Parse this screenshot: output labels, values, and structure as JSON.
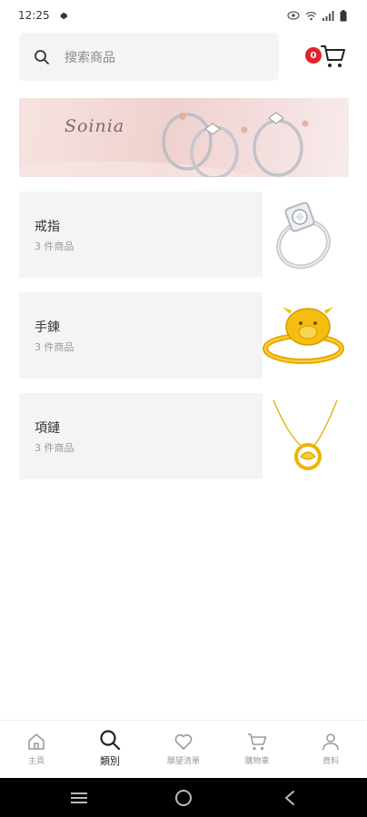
{
  "status_bar": {
    "time": "12:25"
  },
  "search": {
    "placeholder": "搜索商品"
  },
  "cart": {
    "count": "0"
  },
  "banner": {
    "brand_text": "Soinia"
  },
  "categories": [
    {
      "name": "戒指",
      "count": "3 件商品",
      "icon": "ring-image"
    },
    {
      "name": "手鍊",
      "count": "3 件商品",
      "icon": "bracelet-image"
    },
    {
      "name": "項鏈",
      "count": "3 件商品",
      "icon": "necklace-image"
    }
  ],
  "tabs": [
    {
      "label": "主頁",
      "icon": "home-icon",
      "active": false
    },
    {
      "label": "類別",
      "icon": "search-icon",
      "active": true
    },
    {
      "label": "願望清單",
      "icon": "heart-icon",
      "active": false
    },
    {
      "label": "購物車",
      "icon": "cart-icon",
      "active": false
    },
    {
      "label": "資料",
      "icon": "user-icon",
      "active": false
    }
  ],
  "colors": {
    "badge": "#e0232b",
    "gold": "#f2b705",
    "card_bg": "#f4f4f4"
  }
}
